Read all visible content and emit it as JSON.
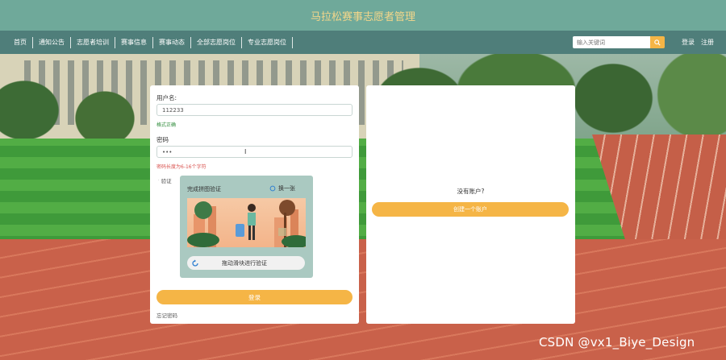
{
  "header": {
    "title": "马拉松赛事志愿者管理"
  },
  "nav": {
    "items": [
      "首页",
      "通知公告",
      "志愿者培训",
      "赛事信息",
      "赛事动态",
      "全部志愿岗位",
      "专业志愿岗位"
    ],
    "search_placeholder": "输入关键词",
    "login": "登录",
    "register": "注册"
  },
  "login": {
    "username_label": "用户名:",
    "username_value": "112233",
    "username_hint": "格式正确",
    "password_label": "密码",
    "password_value": "•••",
    "password_hint": "密码长度为6-16个字符",
    "verify_label": "验证",
    "captcha_title": "完成拼图验证",
    "captcha_refresh": "换一张",
    "slider_text": "拖动滑块进行验证",
    "submit_label": "登录",
    "forgot_label": "忘记密码"
  },
  "register": {
    "prompt": "没有账户?",
    "create_label": "创建一个账户"
  },
  "watermark": "CSDN @vx1_Biye_Design",
  "colors": {
    "accent": "#f5b546",
    "header": "#6fa99a",
    "navbar": "#4f7e7a",
    "hint_ok": "#2e8b3a",
    "hint_error": "#d9534f"
  }
}
